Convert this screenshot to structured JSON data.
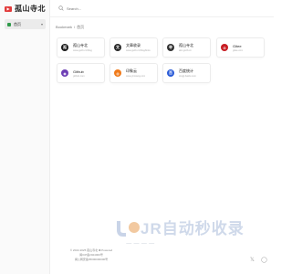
{
  "app": {
    "logo_text": "孤山寺北",
    "logo_badge": "▶"
  },
  "sidebar": {
    "items": [
      {
        "label": "首页",
        "chevron": "▾"
      }
    ],
    "footer": [
      "© 2022-2025 孤山寺北 ✽ Powered",
      "闽ICP备2024000号",
      "闽公网安备35000000000号"
    ]
  },
  "search": {
    "placeholder": "Search..."
  },
  "breadcrumb": {
    "root": "Bookmark",
    "sep": "/",
    "current": "首页"
  },
  "cards": [
    {
      "title": "孤山寺北",
      "sub": "www.gszb.cn/blog",
      "icon_text": "孤",
      "icon_bg": "#1a1a1a"
    },
    {
      "title": "文章收录",
      "sub": "www.gszb.cn/blog/links",
      "icon_text": "文",
      "icon_bg": "#2a2a2a"
    },
    {
      "title": "孤山寺北",
      "sub": "abc.gszb.cn",
      "icon_text": "寺",
      "icon_bg": "#333333"
    },
    {
      "title": "Gitee",
      "sub": "gitee.com",
      "icon_text": "G",
      "icon_bg": "#c71d23"
    },
    {
      "title": "Github",
      "sub": "github.com",
      "icon_text": "◉",
      "icon_bg": "#6e3fb5"
    },
    {
      "title": "印象云",
      "sub": "www.yinxiang.com",
      "icon_text": "◍",
      "icon_bg": "#f07a1a"
    },
    {
      "title": "百度统计",
      "sub": "tongji.baidu.com",
      "icon_text": "百",
      "icon_bg": "#2a5bd7"
    }
  ],
  "watermark": {
    "big": "JR自动秒收录",
    "small": "一 一 一 一"
  },
  "social": {
    "x": "𝕏",
    "github": "◯"
  }
}
